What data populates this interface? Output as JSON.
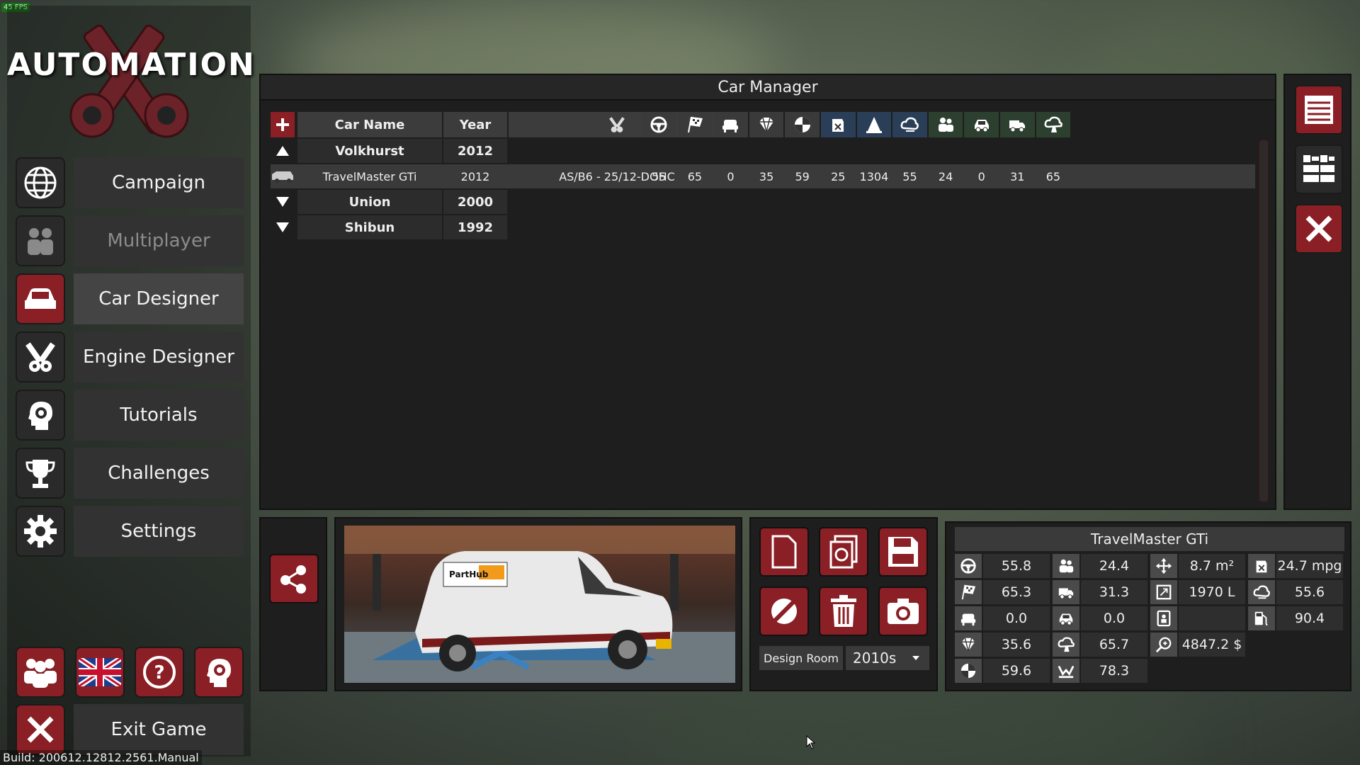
{
  "fps": "45 FPS",
  "build": "Build: 200612.12812.2561.Manual",
  "logo_text": "AUTOMATION",
  "menu": [
    {
      "label": "Campaign",
      "icon": "globe-icon"
    },
    {
      "label": "Multiplayer",
      "icon": "players-icon"
    },
    {
      "label": "Car Designer",
      "icon": "car-icon"
    },
    {
      "label": "Engine Designer",
      "icon": "engine-icon"
    },
    {
      "label": "Tutorials",
      "icon": "head-gear-icon"
    },
    {
      "label": "Challenges",
      "icon": "trophy-icon"
    },
    {
      "label": "Settings",
      "icon": "gear-icon"
    }
  ],
  "exit_label": "Exit Game",
  "car_manager": {
    "title": "Car Manager",
    "headers": {
      "name": "Car Name",
      "year": "Year"
    },
    "stat_icons": [
      "steering-wheel-icon",
      "race-flag-icon",
      "seat-comfort-icon",
      "prestige-diamond-icon",
      "safety-icon",
      "fuel-can-icon",
      "cone-icon",
      "cloud-icon",
      "passengers-icon",
      "offroad-car-icon",
      "cargo-truck-icon",
      "reliability-icon"
    ],
    "rows": [
      {
        "type": "brand",
        "expanded": true,
        "name": "Volkhurst",
        "year": "2012"
      },
      {
        "type": "car",
        "name": "TravelMaster GTi",
        "year": "2012",
        "engine": "AS/B6 - 25/12-DOHC",
        "stats": [
          "55",
          "65",
          "0",
          "35",
          "59",
          "25",
          "1304",
          "55",
          "24",
          "0",
          "31",
          "65"
        ]
      },
      {
        "type": "brand",
        "expanded": false,
        "name": "Union",
        "year": "2000"
      },
      {
        "type": "brand",
        "expanded": false,
        "name": "Shibun",
        "year": "1992"
      }
    ]
  },
  "preview": {
    "sticker_brand": "PartHub"
  },
  "design_room": {
    "label": "Design Room",
    "era": "2010s"
  },
  "stats_panel": {
    "title": "TravelMaster GTi",
    "col1": [
      "55.8",
      "65.3",
      "0.0",
      "35.6",
      "59.6"
    ],
    "col2": [
      "24.4",
      "31.3",
      "0.0",
      "65.7",
      "78.3"
    ],
    "col3": [
      "8.7 m²",
      "1970 L",
      "",
      "4847.2 $"
    ],
    "col4": [
      "24.7 mpg",
      "55.6",
      "90.4"
    ]
  },
  "colors": {
    "accent_red": "#8a1f25",
    "panel": "#1e1e1e",
    "header": "#3c3c3c"
  }
}
